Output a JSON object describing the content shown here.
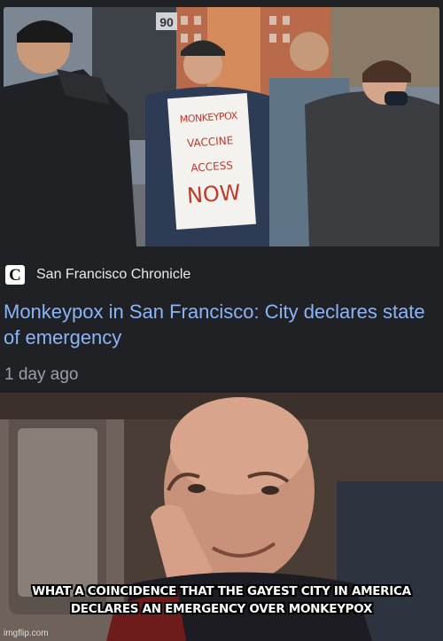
{
  "article": {
    "sign_text": [
      "MONKEYPOX",
      "VACCINE",
      "ACCESS",
      "NOW"
    ],
    "building_number": "90",
    "source_logo": "C",
    "source_name": "San Francisco Chronicle",
    "headline": "Monkeypox in San Francisco: City declares state of emergency",
    "time_ago": "1 day ago"
  },
  "meme": {
    "caption": "WHAT A COINCIDENCE THAT THE GAYEST CITY IN AMERICA DECLARES AN EMERGENCY OVER MONKEYPOX",
    "watermark": "imgflip.com"
  },
  "colors": {
    "card_background": "#202124",
    "headline": "#8ab4f8",
    "source_text": "#e8eaed",
    "time_text": "#9aa0a6",
    "sign_marker": "#c0392b"
  }
}
